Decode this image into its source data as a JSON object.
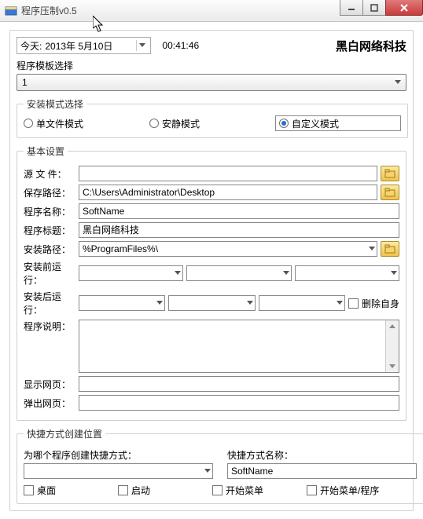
{
  "window": {
    "title": "程序压制v0.5"
  },
  "top": {
    "today_label": "今天:",
    "date_value": "2013年 5月10日",
    "time_value": "00:41:46",
    "brand": "黑白网络科技"
  },
  "template": {
    "label": "程序模板选择",
    "value": "1"
  },
  "install_mode": {
    "legend": "安装模式选择",
    "single": "单文件模式",
    "silent": "安静模式",
    "custom": "自定义模式"
  },
  "basic": {
    "legend": "基本设置",
    "source_label": "源 文 件：",
    "save_label": "保存路径：",
    "save_value": "C:\\Users\\Administrator\\Desktop",
    "name_label": "程序名称：",
    "name_value": "SoftName",
    "title_label": "程序标题：",
    "title_value": "黑白网络科技",
    "path_label": "安装路径：",
    "path_value": "%ProgramFiles%\\",
    "before_label": "安装前运行：",
    "after_label": "安装后运行：",
    "delete_self": "删除自身",
    "desc_label": "程序说明：",
    "show_label": "显示网页：",
    "pop_label": "弹出网页："
  },
  "shortcut": {
    "legend": "快捷方式创建位置",
    "for_label": "为哪个程序创建快捷方式：",
    "name_label": "快捷方式名称：",
    "name_value": "SoftName",
    "desktop": "桌面",
    "startup": "启动",
    "startmenu": "开始菜单",
    "startmenu_prog": "开始菜单/程序"
  }
}
